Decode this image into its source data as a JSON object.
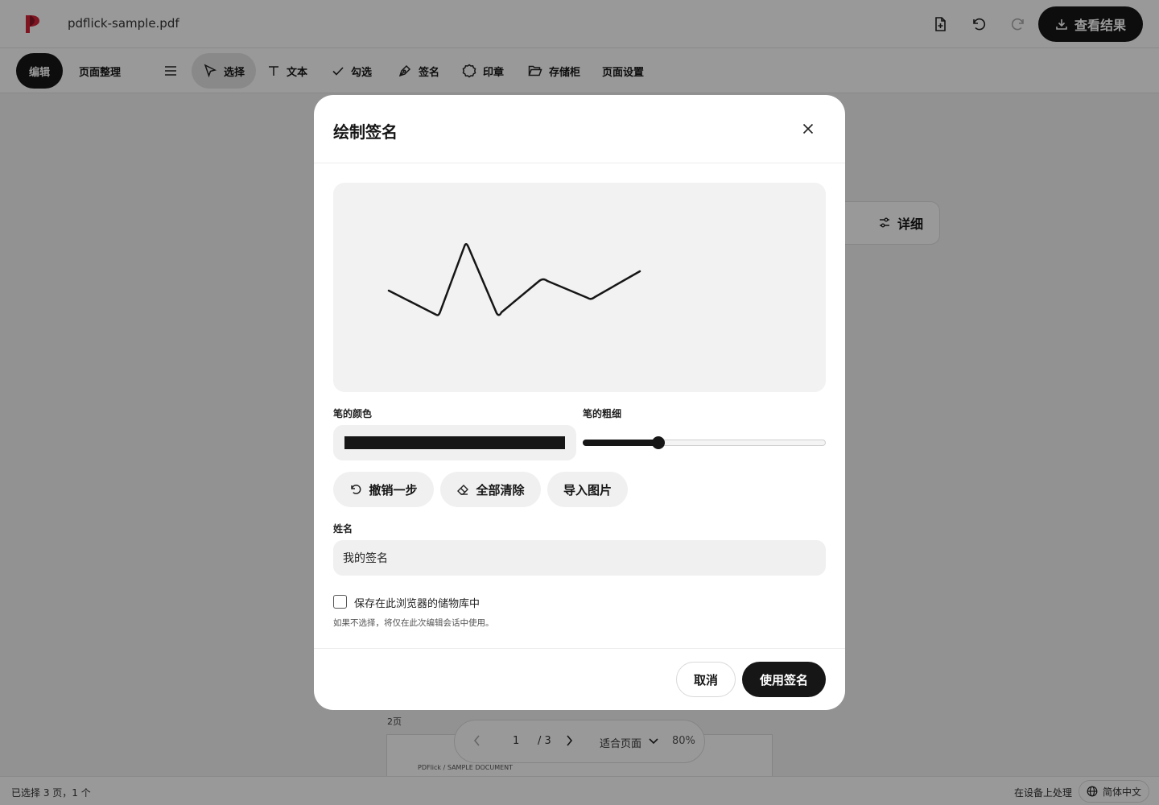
{
  "app": {
    "filename": "pdflick-sample.pdf",
    "view_result_label": "查看结果",
    "brand_color": "#d6243a"
  },
  "toolbar": {
    "modes": {
      "edit": "编辑",
      "organize": "页面整理"
    },
    "tools": {
      "select": "选择",
      "text": "文本",
      "check": "勾选",
      "sign": "签名",
      "stamp": "印章",
      "storage": "存储柜",
      "page_settings": "页面设置"
    }
  },
  "side_panel": {
    "details_label": "详细"
  },
  "document": {
    "page_label": "2页",
    "page_header": "PDFlick / SAMPLE DOCUMENT"
  },
  "pager": {
    "current_page": "1",
    "total": "/ 3",
    "fit_label": "适合页面",
    "zoom": "80%"
  },
  "status": {
    "selection": "已选择 3 页，1 个",
    "processing": "在设备上处理",
    "language": "简体中文"
  },
  "dialog": {
    "title": "绘制签名",
    "pen_color_label": "笔的颜色",
    "pen_color": "#161616",
    "pen_width_label": "笔的粗细",
    "pen_width_fraction": 0.31,
    "undo_label": "撤销一步",
    "clear_label": "全部清除",
    "import_label": "导入图片",
    "name_label": "姓名",
    "name_value": "我的签名",
    "save_label": "保存在此浏览器的储物库中",
    "save_checked": false,
    "hint": "如果不选择，将仅在此次编辑会话中使用。",
    "cancel_label": "取消",
    "use_label": "使用签名"
  }
}
